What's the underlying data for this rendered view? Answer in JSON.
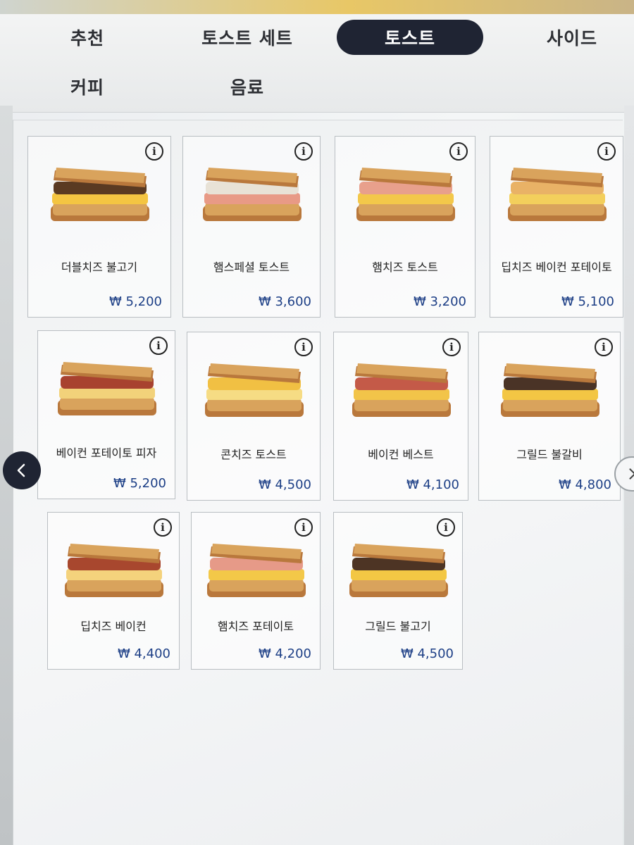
{
  "tabs": [
    {
      "label": "추천",
      "active": false
    },
    {
      "label": "토스트 세트",
      "active": false
    },
    {
      "label": "토스트",
      "active": true
    },
    {
      "label": "사이드",
      "active": false
    },
    {
      "label": "커피",
      "active": false
    },
    {
      "label": "음료",
      "active": false
    }
  ],
  "menu": {
    "info_glyph": "i",
    "items": [
      {
        "name": "더블치즈 불고기",
        "price": "₩ 5,200",
        "filling": "#5a3a22",
        "filling2": "#f4c542"
      },
      {
        "name": "햄스페셜 토스트",
        "price": "₩ 3,600",
        "filling": "#e8e2d6",
        "filling2": "#e89a86"
      },
      {
        "name": "햄치즈 토스트",
        "price": "₩ 3,200",
        "filling": "#e8a08c",
        "filling2": "#f3c84a"
      },
      {
        "name": "딥치즈 베이컨 포테이토",
        "price": "₩ 5,100",
        "filling": "#e9b266",
        "filling2": "#f3cf5c"
      },
      {
        "name": "베이컨 포테이토 피자",
        "price": "₩ 5,200",
        "filling": "#a8422f",
        "filling2": "#f2d27a"
      },
      {
        "name": "콘치즈 토스트",
        "price": "₩ 4,500",
        "filling": "#f1c043",
        "filling2": "#f6dc84"
      },
      {
        "name": "베이컨 베스트",
        "price": "₩ 4,100",
        "filling": "#c45a48",
        "filling2": "#f2c449"
      },
      {
        "name": "그릴드 불갈비",
        "price": "₩ 4,800",
        "filling": "#4a3326",
        "filling2": "#f3c644"
      },
      {
        "name": "딥치즈 베이컨",
        "price": "₩ 4,400",
        "filling": "#a8472e",
        "filling2": "#f4d27c"
      },
      {
        "name": "햄치즈 포테이토",
        "price": "₩ 4,200",
        "filling": "#e69a88",
        "filling2": "#f3c848"
      },
      {
        "name": "그릴드 불고기",
        "price": "₩ 4,500",
        "filling": "#4d3424",
        "filling2": "#f3c744"
      }
    ]
  },
  "nav": {
    "prev_icon": "chevron-left-icon",
    "next_icon": "chevron-right-icon"
  },
  "colors": {
    "accent": "#1f2433",
    "price": "#1d3f86",
    "toast": "#d9a35c",
    "crust": "#b9783c"
  }
}
